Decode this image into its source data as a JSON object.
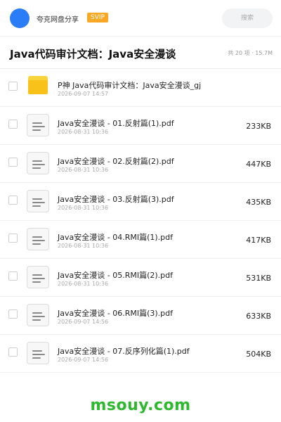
{
  "header": {
    "brand": "夸克网盘分享",
    "svip_badge": "SVIP",
    "search_placeholder": "搜索"
  },
  "folder": {
    "title": "Java代码审计文档：Java安全漫谈",
    "meta": "共 20 项 · 15.7M"
  },
  "files": [
    {
      "type": "folder",
      "name": "P神 Java代码审计文档：Java安全漫谈_gj",
      "date": "2026-09-07 14:57",
      "size": ""
    },
    {
      "type": "pdf",
      "name": "Java安全漫谈 - 01.反射篇(1).pdf",
      "date": "2026-08-31 10:36",
      "size": "233KB"
    },
    {
      "type": "pdf",
      "name": "Java安全漫谈 - 02.反射篇(2).pdf",
      "date": "2026-08-31 10:36",
      "size": "447KB"
    },
    {
      "type": "pdf",
      "name": "Java安全漫谈 - 03.反射篇(3).pdf",
      "date": "2026-08-31 10:36",
      "size": "435KB"
    },
    {
      "type": "pdf",
      "name": "Java安全漫谈 - 04.RMI篇(1).pdf",
      "date": "2026-08-31 10:36",
      "size": "417KB"
    },
    {
      "type": "pdf",
      "name": "Java安全漫谈 - 05.RMI篇(2).pdf",
      "date": "2026-08-31 10:36",
      "size": "531KB"
    },
    {
      "type": "pdf",
      "name": "Java安全漫谈 - 06.RMI篇(3).pdf",
      "date": "2026-09-07 14:56",
      "size": "633KB"
    },
    {
      "type": "pdf",
      "name": "Java安全漫谈 - 07.反序列化篇(1).pdf",
      "date": "2026-09-07 14:56",
      "size": "504KB"
    }
  ],
  "watermark": "msouy.com",
  "colors": {
    "avatar": "#2a7cf7",
    "svip": "#f9a825",
    "folder": "#f9c21a",
    "watermark": "#2eb82e"
  }
}
